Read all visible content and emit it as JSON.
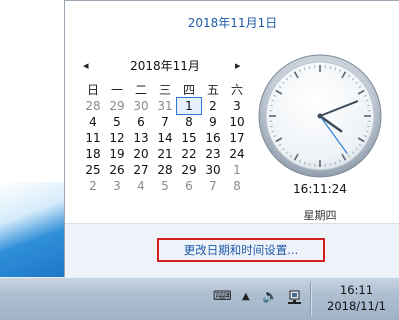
{
  "header": {
    "date_long": "2018年11月1日"
  },
  "calendar": {
    "month_title": "2018年11月",
    "prev_glyph": "◂",
    "next_glyph": "▸",
    "weekdays": [
      "日",
      "一",
      "二",
      "三",
      "四",
      "五",
      "六"
    ],
    "weeks": [
      [
        "28",
        "29",
        "30",
        "31",
        "1",
        "2",
        "3"
      ],
      [
        "4",
        "5",
        "6",
        "7",
        "8",
        "9",
        "10"
      ],
      [
        "11",
        "12",
        "13",
        "14",
        "15",
        "16",
        "17"
      ],
      [
        "18",
        "19",
        "20",
        "21",
        "22",
        "23",
        "24"
      ],
      [
        "25",
        "26",
        "27",
        "28",
        "29",
        "30",
        "1"
      ],
      [
        "2",
        "3",
        "4",
        "5",
        "6",
        "7",
        "8"
      ]
    ]
  },
  "clock": {
    "time": "16:11:24",
    "weekday": "星期四",
    "hour": 16,
    "minute": 11,
    "second": 24
  },
  "footer": {
    "settings_link": "更改日期和时间设置..."
  },
  "taskbar": {
    "time": "16:11",
    "date": "2018/11/1",
    "icons": [
      "keyboard-icon",
      "show-hidden-icons-icon",
      "volume-icon",
      "network-icon"
    ]
  }
}
